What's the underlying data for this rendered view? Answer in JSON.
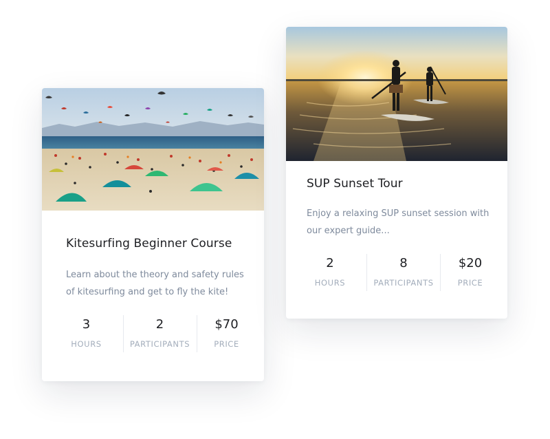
{
  "cards": [
    {
      "title": "Kitesurfing Beginner Course",
      "description": "Learn about the theory and safety rules of kitesurfing and get to fly the kite!",
      "image": "kitesurfing-beach-photo",
      "stats": [
        {
          "value": "3",
          "label": "HOURS"
        },
        {
          "value": "2",
          "label": "PARTICIPANTS"
        },
        {
          "value": "$70",
          "label": "PRICE"
        }
      ]
    },
    {
      "title": "SUP Sunset Tour",
      "description": "Enjoy a relaxing SUP sunset session with our expert guide...",
      "image": "sup-sunset-photo",
      "stats": [
        {
          "value": "2",
          "label": "HOURS"
        },
        {
          "value": "8",
          "label": "PARTICIPANTS"
        },
        {
          "value": "$20",
          "label": "PRICE"
        }
      ]
    }
  ],
  "colors": {
    "title": "#1d1e22",
    "description": "#7e8a9c",
    "stat_label": "#a3adbb",
    "divider": "#e6e9ee"
  }
}
